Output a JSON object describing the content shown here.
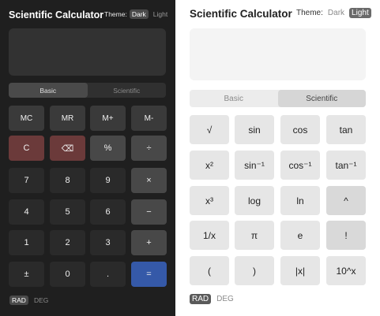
{
  "dark": {
    "title": "Scientific Calculator",
    "theme_label": "Theme:",
    "theme_dark": "Dark",
    "theme_light": "Light",
    "mode_basic": "Basic",
    "mode_scientific": "Scientific",
    "keys": {
      "mc": "MC",
      "mr": "MR",
      "mplus": "M+",
      "mminus": "M-",
      "clear": "C",
      "backspace": "⌫",
      "percent": "%",
      "divide": "÷",
      "k7": "7",
      "k8": "8",
      "k9": "9",
      "multiply": "×",
      "k4": "4",
      "k5": "5",
      "k6": "6",
      "minus": "−",
      "k1": "1",
      "k2": "2",
      "k3": "3",
      "plus": "+",
      "plusminus": "±",
      "k0": "0",
      "decimal": ".",
      "equals": "="
    },
    "angle_rad": "RAD",
    "angle_deg": "DEG"
  },
  "light": {
    "title": "Scientific Calculator",
    "theme_label": "Theme:",
    "theme_dark": "Dark",
    "theme_light": "Light",
    "mode_basic": "Basic",
    "mode_scientific": "Scientific",
    "keys": {
      "sqrt": "√",
      "sin": "sin",
      "cos": "cos",
      "tan": "tan",
      "square": "x²",
      "asin": "sin⁻¹",
      "acos": "cos⁻¹",
      "atan": "tan⁻¹",
      "cube": "x³",
      "log": "log",
      "ln": "ln",
      "power": "^",
      "reciprocal": "1/x",
      "pi": "π",
      "e": "e",
      "factorial": "!",
      "lparen": "(",
      "rparen": ")",
      "abs": "|x|",
      "tenpow": "10^x"
    },
    "angle_rad": "RAD",
    "angle_deg": "DEG"
  }
}
